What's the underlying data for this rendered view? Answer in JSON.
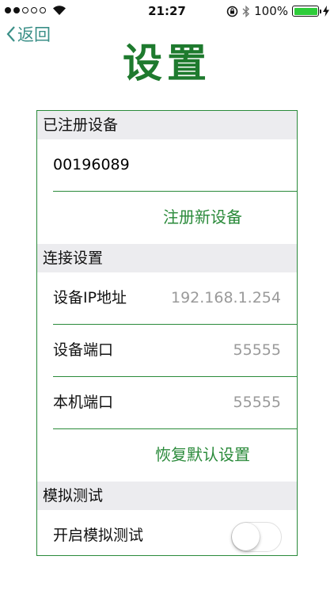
{
  "status_bar": {
    "time": "21:27",
    "battery_percent": "100%",
    "signal_filled": 2,
    "signal_total": 5,
    "battery_fill_fraction": 1.0
  },
  "nav": {
    "back_label": "返回",
    "title": "设置"
  },
  "sections": {
    "registered": {
      "header": "已注册设备",
      "device_id": "00196089",
      "register_action": "注册新设备"
    },
    "connection": {
      "header": "连接设置",
      "ip_label": "设备IP地址",
      "ip_value": "192.168.1.254",
      "port_label": "设备端口",
      "port_value": "55555",
      "local_port_label": "本机端口",
      "local_port_value": "55555",
      "reset_action": "恢复默认设置"
    },
    "simulation": {
      "header": "模拟测试",
      "toggle_label": "开启模拟测试",
      "toggle_on": false
    }
  },
  "colors": {
    "accent_green": "#2a8a3a",
    "title_green": "#1e7a2e",
    "back_teal": "#3a8f87",
    "value_gray": "#9a9a9a",
    "section_bg": "#ececef"
  }
}
